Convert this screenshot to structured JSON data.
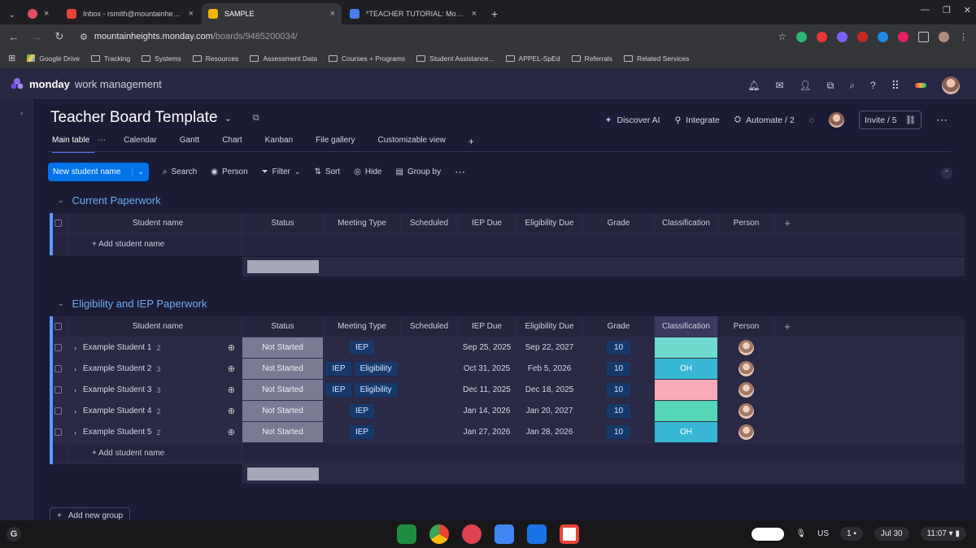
{
  "browser": {
    "tabs": [
      {
        "title": "",
        "favicon_color": "#e64c65"
      },
      {
        "title": "Inbox - rsmith@mountainheig...",
        "favicon_color": "#e94235"
      },
      {
        "title": "SAMPLE",
        "favicon_color": "#f5b400"
      },
      {
        "title": "*TEACHER TUTORIAL: Monda...",
        "favicon_color": "#4a7ef0"
      }
    ],
    "url_domain": "mountainheights.monday.com",
    "url_path": "/boards/9485200034/",
    "bookmarks": [
      "Google Drive",
      "Tracking",
      "Systems",
      "Resources",
      "Assessment Data",
      "Courses + Programs",
      "Student Assistance...",
      "APPEL-SpEd",
      "Referrals",
      "Related Services"
    ]
  },
  "app": {
    "brand": "monday",
    "product": "work management"
  },
  "board": {
    "title": "Teacher Board Template",
    "actions": {
      "discover_ai": "Discover AI",
      "integrate": "Integrate",
      "automate": "Automate / 2",
      "invite": "Invite / 5"
    },
    "views": [
      "Main table",
      "Calendar",
      "Gantt",
      "Chart",
      "Kanban",
      "File gallery",
      "Customizable view"
    ],
    "toolbar": {
      "new_item": "New student name",
      "search": "Search",
      "person": "Person",
      "filter": "Filter",
      "sort": "Sort",
      "hide": "Hide",
      "group_by": "Group by"
    },
    "columns": {
      "name": "Student name",
      "status": "Status",
      "meeting": "Meeting Type",
      "scheduled": "Scheduled",
      "iep_due": "IEP Due",
      "elig_due": "Eligibility Due",
      "grade": "Grade",
      "classification": "Classification",
      "person": "Person"
    },
    "add_item": "+ Add student name",
    "add_group": "Add new group",
    "groups": [
      {
        "title": "Current Paperwork",
        "color": "#579bfc"
      },
      {
        "title": "Eligibility and IEP Paperwork",
        "color": "#579bfc"
      }
    ],
    "rows": [
      {
        "name": "Example Student 1",
        "updates": "2",
        "status": "Not Started",
        "meeting": [
          "IEP"
        ],
        "iep_due": "Sep 25, 2025",
        "elig_due": "Sep 22, 2027",
        "grade": "10",
        "classification": "",
        "class_color": "#6fd9d0"
      },
      {
        "name": "Example Student 2",
        "updates": "3",
        "status": "Not Started",
        "meeting": [
          "IEP",
          "Eligibility"
        ],
        "iep_due": "Oct 31, 2025",
        "elig_due": "Feb 5, 2026",
        "grade": "10",
        "classification": "OH",
        "class_color": "#38b7d4"
      },
      {
        "name": "Example Student 3",
        "updates": "3",
        "status": "Not Started",
        "meeting": [
          "IEP",
          "Eligibility"
        ],
        "iep_due": "Dec 11, 2025",
        "elig_due": "Dec 18, 2025",
        "grade": "10",
        "classification": "",
        "class_color": "#f8aab8"
      },
      {
        "name": "Example Student 4",
        "updates": "2",
        "status": "Not Started",
        "meeting": [
          "IEP"
        ],
        "iep_due": "Jan 14, 2026",
        "elig_due": "Jan 20, 2027",
        "grade": "10",
        "classification": "",
        "class_color": "#55d6b8"
      },
      {
        "name": "Example Student 5",
        "updates": "2",
        "status": "Not Started",
        "meeting": [
          "IEP"
        ],
        "iep_due": "Jan 27, 2026",
        "elig_due": "Jan 28, 2026",
        "grade": "10",
        "classification": "OH",
        "class_color": "#38b7d4"
      }
    ]
  },
  "shelf": {
    "lang": "US",
    "notif_count": "1",
    "date": "Jul 30",
    "time": "11:07"
  }
}
